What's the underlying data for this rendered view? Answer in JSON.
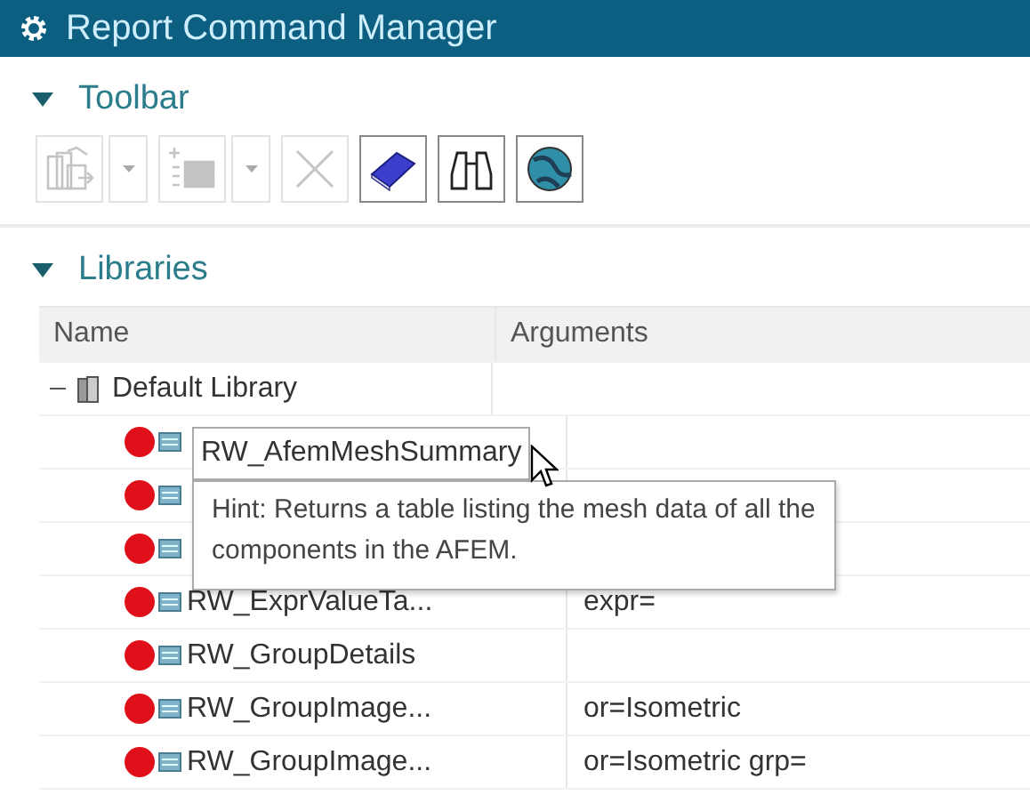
{
  "window": {
    "title": "Report Command Manager"
  },
  "toolbar_section": {
    "title": "Toolbar",
    "expanded": true,
    "buttons": [
      {
        "kind": "add-library",
        "disabled": true,
        "dropdown": true
      },
      {
        "kind": "add-command",
        "disabled": true,
        "dropdown": true
      },
      {
        "kind": "delete",
        "disabled": true,
        "dropdown": false
      },
      {
        "kind": "book",
        "disabled": false,
        "dropdown": false
      },
      {
        "kind": "binoculars",
        "disabled": false,
        "dropdown": false
      },
      {
        "kind": "globe",
        "disabled": false,
        "dropdown": false
      }
    ]
  },
  "libraries_section": {
    "title": "Libraries",
    "expanded": true,
    "table": {
      "columns": [
        "Name",
        "Arguments"
      ],
      "tree": [
        {
          "name": "Default Library",
          "expanded": true,
          "children": [
            {
              "color": "#e0101a"
            },
            {
              "color": "#e0101a"
            },
            {
              "color": "#e0101a"
            },
            {
              "color": "#e0101a",
              "name": "RW_ExprValueTa...",
              "arguments": "expr="
            },
            {
              "color": "#e0101a",
              "name": "RW_GroupDetails"
            },
            {
              "color": "#e0101a",
              "name": "RW_GroupImage...",
              "arguments": "or=Isometric"
            },
            {
              "color": "#e0101a",
              "name": "RW_GroupImage...",
              "arguments": "or=Isometric grp="
            }
          ]
        }
      ]
    },
    "name_tooltip": "RW_AfemMeshSummary",
    "hint_tooltip": "Hint: Returns a table listing the mesh data of all the components in the AFEM."
  }
}
